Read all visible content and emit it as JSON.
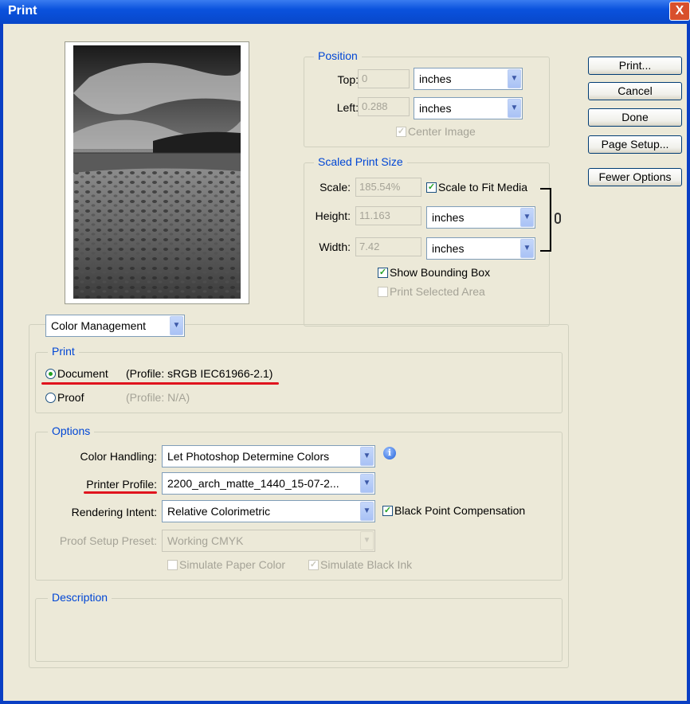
{
  "window": {
    "title": "Print",
    "close_glyph": "X"
  },
  "buttons": {
    "print": "Print...",
    "cancel": "Cancel",
    "done": "Done",
    "page_setup": "Page Setup...",
    "fewer_options": "Fewer Options"
  },
  "position": {
    "legend": "Position",
    "top_label": "Top:",
    "top_value": "0",
    "top_unit": "inches",
    "left_label": "Left:",
    "left_value": "0.288",
    "left_unit": "inches",
    "center_image": "Center Image"
  },
  "scaled": {
    "legend": "Scaled Print Size",
    "scale_label": "Scale:",
    "scale_value": "185.54%",
    "scale_to_fit": "Scale to Fit Media",
    "height_label": "Height:",
    "height_value": "11.163",
    "height_unit": "inches",
    "width_label": "Width:",
    "width_value": "7.42",
    "width_unit": "inches",
    "show_bounding_box": "Show Bounding Box",
    "print_selected_area": "Print Selected Area"
  },
  "mode_select": "Color Management",
  "print_group": {
    "legend": "Print",
    "document_label": "Document",
    "document_profile": "(Profile: sRGB IEC61966-2.1)",
    "proof_label": "Proof",
    "proof_profile": "(Profile: N/A)"
  },
  "options": {
    "legend": "Options",
    "color_handling_label": "Color Handling:",
    "color_handling_value": "Let Photoshop Determine Colors",
    "printer_profile_label": "Printer Profile:",
    "printer_profile_value": "2200_arch_matte_1440_15-07-2...",
    "rendering_intent_label": "Rendering Intent:",
    "rendering_intent_value": "Relative Colorimetric",
    "black_point": "Black Point Compensation",
    "proof_setup_label": "Proof Setup Preset:",
    "proof_setup_value": "Working CMYK",
    "simulate_paper": "Simulate Paper Color",
    "simulate_black": "Simulate Black Ink"
  },
  "description": {
    "legend": "Description"
  },
  "colors": {
    "accent": "#0046d5",
    "annotation": "#e0141e",
    "check": "#21a121"
  }
}
